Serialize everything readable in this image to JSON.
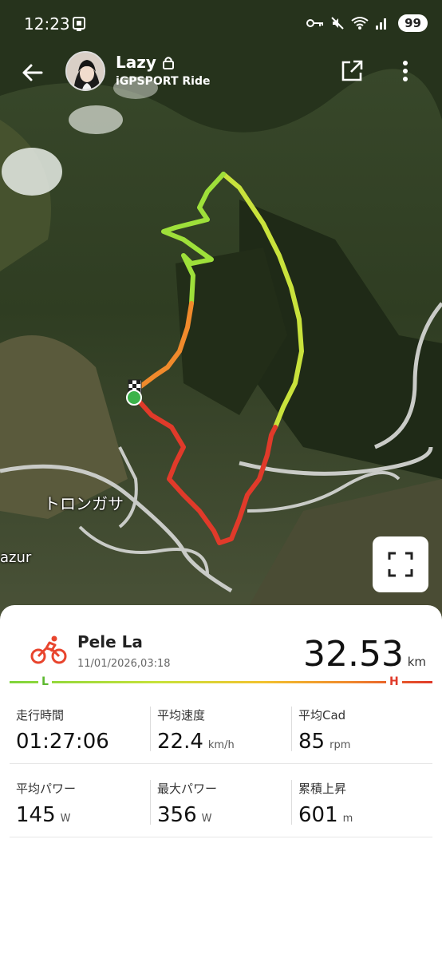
{
  "status_bar": {
    "time": "12:23",
    "battery": "99",
    "icons": [
      "notification-icon",
      "key-icon",
      "mute-icon",
      "wifi-icon",
      "signal-icon"
    ]
  },
  "header": {
    "user_name": "Lazy",
    "subtitle": "iGPSPORT Ride"
  },
  "map": {
    "place_label_1": "トロンガサ",
    "place_label_2": "azur"
  },
  "activity": {
    "name": "Pele La",
    "datetime": "11/01/2026,03:18",
    "distance": "32.53",
    "distance_unit": "km",
    "gradient_low": "L",
    "gradient_high": "H"
  },
  "stats": [
    {
      "label": "走行時間",
      "value": "01:27:06",
      "unit": ""
    },
    {
      "label": "平均速度",
      "value": "22.4",
      "unit": "km/h"
    },
    {
      "label": "平均Cad",
      "value": "85",
      "unit": "rpm"
    },
    {
      "label": "平均パワー",
      "value": "145",
      "unit": "W"
    },
    {
      "label": "最大パワー",
      "value": "356",
      "unit": "W"
    },
    {
      "label": "累積上昇",
      "value": "601",
      "unit": "m"
    }
  ],
  "tabs": [
    "summary-tab",
    "laps-tab",
    "charts-tab",
    "details-tab"
  ],
  "colors": {
    "accent": "#e8452e",
    "route_low": "#7fd43c",
    "route_high": "#e03a2a"
  }
}
